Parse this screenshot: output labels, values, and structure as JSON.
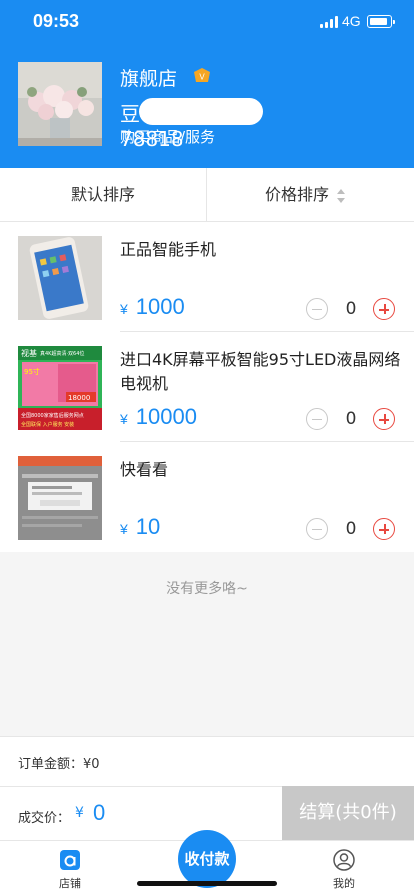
{
  "status_bar": {
    "time": "09:53",
    "network": "4G"
  },
  "shop": {
    "name": "旗舰店",
    "badge": "V",
    "phone_prefix": "豆",
    "phone_suffix": "78818",
    "description": "购买商品/服务"
  },
  "sort": {
    "default_label": "默认排序",
    "price_label": "价格排序"
  },
  "products": [
    {
      "name": "正品智能手机",
      "currency": "¥",
      "price": "1000",
      "qty": "0"
    },
    {
      "name": "进口4K屏幕平板智能95寸LED液晶网络电视机",
      "currency": "¥",
      "price": "10000",
      "qty": "0",
      "thumb_text": {
        "brand": "视基",
        "tagline": "真4K超高清·双64位",
        "size": "95寸",
        "price": "18000",
        "footer1": "全国8000家家售后服务网点",
        "footer2": "全国联保 入户服务 安装"
      }
    },
    {
      "name": "快看看",
      "currency": "¥",
      "price": "10",
      "qty": "0"
    }
  ],
  "no_more_text": "没有更多咯~",
  "order_total": {
    "label": "订单金额：¥0"
  },
  "deal": {
    "label": "成交价：",
    "currency": "¥",
    "value": "0"
  },
  "checkout_label": "结算(共0件)",
  "tabbar": {
    "shop_label": "店铺",
    "pay_label": "收付款",
    "mine_label": "我的"
  },
  "colors": {
    "primary": "#1a8cf2",
    "danger": "#e8483f",
    "disabled": "#c8c8c8"
  }
}
